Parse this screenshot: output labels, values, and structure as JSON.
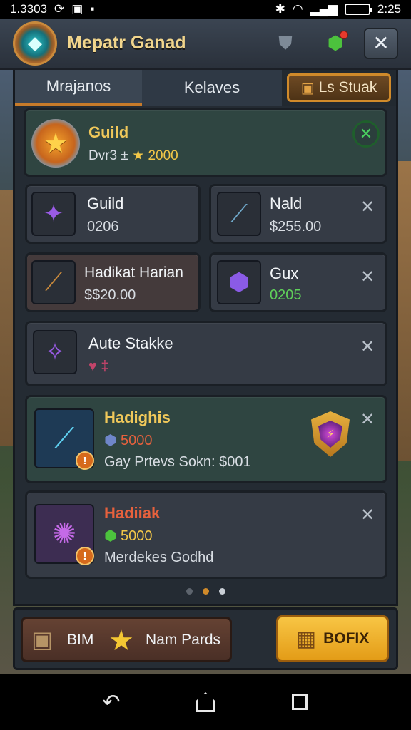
{
  "status_bar": {
    "time_left": "1.3303",
    "time_right": "2:25"
  },
  "header": {
    "title": "Mepatr Ganad"
  },
  "tabs": [
    {
      "label": "Mrajanos"
    },
    {
      "label": "Kelaves"
    },
    {
      "label": "Ls Stuak"
    }
  ],
  "featured": {
    "name": "Guild",
    "detail_prefix": "Dvr3 ±",
    "detail_value": "2000"
  },
  "items": [
    {
      "name": "Guild",
      "value": "0206"
    },
    {
      "name": "Nald",
      "value": "$255.00"
    },
    {
      "name": "Hadikat Harian",
      "value": "$$20.00"
    },
    {
      "name": "Gux",
      "value": "0205"
    },
    {
      "name": "Aute Stakke",
      "value": "♥ ‡"
    }
  ],
  "offers": [
    {
      "name": "Hadighis",
      "price": "5000",
      "note": "Gay Prtevs Sokn: $001"
    },
    {
      "name": "Hadiiak",
      "price": "5000",
      "note": "Merdekes Godhd"
    }
  ],
  "bottom": {
    "left_label_1": "BIM",
    "left_label_2": "Nam Pards",
    "right_label": "BOFIX"
  },
  "colors": {
    "accent": "#d08a2a",
    "gold_text": "#f0c85a",
    "green_value": "#5fd05a"
  }
}
